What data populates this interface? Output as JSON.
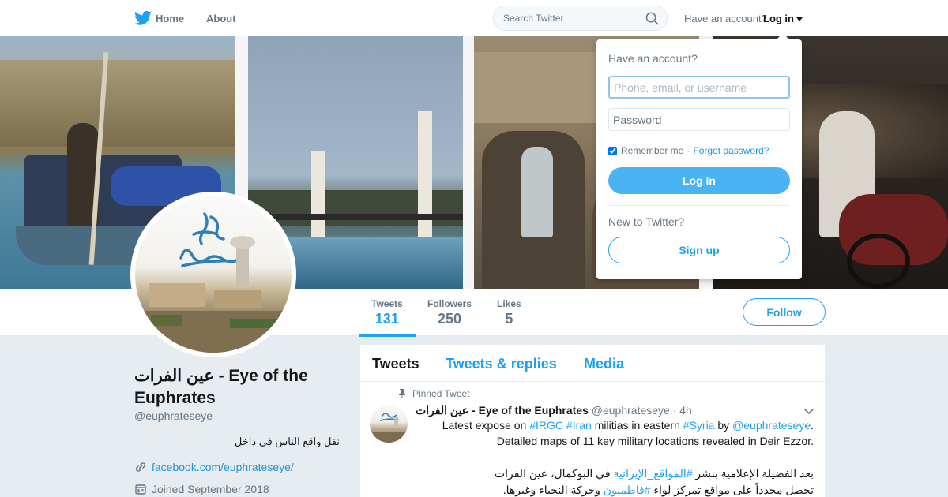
{
  "nav": {
    "home_label": "Home",
    "about_label": "About",
    "search_placeholder": "Search Twitter",
    "have_account": "Have an account?",
    "login_label": "Log in"
  },
  "login_dropdown": {
    "title": "Have an account?",
    "phone_placeholder": "Phone, email, or username",
    "password_placeholder": "Password",
    "remember_label": "Remember me",
    "separator": "·",
    "forgot_label": "Forgot password?",
    "login_button": "Log in",
    "new_label": "New to Twitter?",
    "signup_button": "Sign up"
  },
  "profile": {
    "name": "عين الفرات - Eye of the Euphrates",
    "handle": "@euphrateseye",
    "bio": "نقل واقع الناس في داخل",
    "link": "facebook.com/euphrateseye/",
    "joined": "Joined September 2018",
    "follow_button": "Follow"
  },
  "stats": [
    {
      "label": "Tweets",
      "value": "131"
    },
    {
      "label": "Followers",
      "value": "250"
    },
    {
      "label": "Likes",
      "value": "5"
    }
  ],
  "tabs": {
    "tweets": "Tweets",
    "replies": "Tweets & replies",
    "media": "Media"
  },
  "tweet": {
    "pinned_label": "Pinned Tweet",
    "name": "عين الفرات - Eye of the Euphrates",
    "handle": "@euphrateseye",
    "time": "· 4h",
    "line1_a": "Latest expose on ",
    "line1_tag1": "#IRGC",
    "line1_tag2": "#Iran",
    "line1_b": " militias in eastern ",
    "line1_tag3": "#Syria",
    "line1_c": " by ",
    "line1_mention": "@euphrateseye",
    "line1_d": ".",
    "line2": "Detailed maps of 11 key military locations revealed in Deir Ezzor.",
    "line3_a": "بعد الفضيلة الإعلامية بنشر ",
    "line3_tag": "#المواقع_الإيرانية",
    "line3_b": " في البوكمال، عين الفرات",
    "line4_a": "تحصل مجدداً على مواقع تمركز لواء ",
    "line4_tag": "#فاطميون",
    "line4_b": " وحركة النجباء وغيرها."
  },
  "colors": {
    "accent": "#1da1f2",
    "button_fill": "#4ab3f4",
    "background": "#e6ecf0"
  },
  "icons": [
    "twitter-bird-icon",
    "search-icon",
    "caret-down-icon",
    "link-icon",
    "calendar-icon",
    "pin-icon",
    "chevron-down-icon"
  ]
}
